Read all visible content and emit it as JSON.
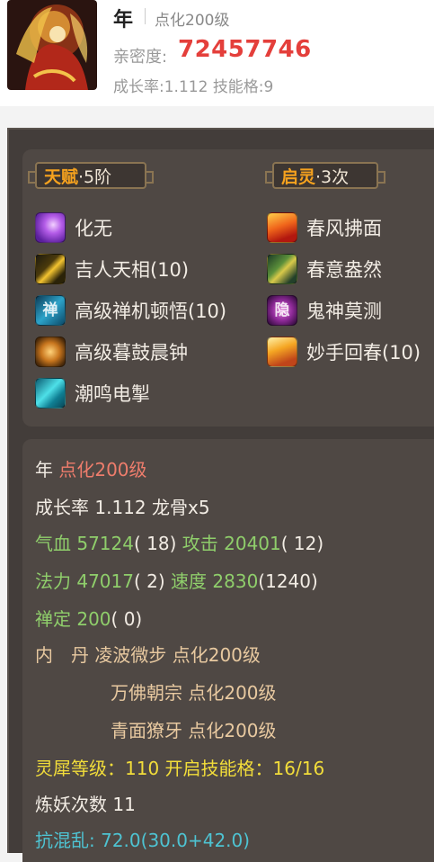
{
  "header": {
    "name": "年",
    "level": "点化200级",
    "intimacy_label": "亲密度:",
    "intimacy_value": "72457746",
    "growth_label": "成长率:1.112",
    "skill_slots_label": "技能格:9"
  },
  "talent": {
    "title": "天赋",
    "rank": "·5阶"
  },
  "awaken": {
    "title": "启灵",
    "count": "·3次"
  },
  "skills_left": [
    {
      "name": "化无",
      "icon": "huawu-icon"
    },
    {
      "name": "吉人天相(10)",
      "icon": "jiren-icon"
    },
    {
      "name": "高级禅机顿悟(10)",
      "icon": "chanji-icon",
      "glyph": "禅"
    },
    {
      "name": "高级暮鼓晨钟",
      "icon": "mugu-icon"
    },
    {
      "name": "潮鸣电掣",
      "icon": "chaoming-icon"
    }
  ],
  "skills_right": [
    {
      "name": "春风拂面",
      "icon": "chunfeng-icon"
    },
    {
      "name": "春意盎然",
      "icon": "chunyi-icon"
    },
    {
      "name": "鬼神莫测",
      "icon": "guishen-icon",
      "glyph": "隐"
    },
    {
      "name": "妙手回春(10)",
      "icon": "miaoshou-icon"
    }
  ],
  "stats": {
    "name": "年",
    "level": "点化200级",
    "growth_label": "成长率",
    "growth_value": "1.112",
    "dragon_bone": "龙骨x5",
    "hp_label": "气血",
    "hp_value": "57124",
    "hp_extra": "( 18)",
    "atk_label": "攻击",
    "atk_value": "20401",
    "atk_extra": "( 12)",
    "mp_label": "法力",
    "mp_value": "47017",
    "mp_extra": "( 2)",
    "spd_label": "速度",
    "spd_value": "2830",
    "spd_extra": "(1240)",
    "calm_label": "禅定",
    "calm_value": "200",
    "calm_extra": "( 0)",
    "inner_label": "内　丹",
    "inner_cores": [
      {
        "name": "凌波微步",
        "level": "点化200级"
      },
      {
        "name": "万佛朝宗",
        "level": "点化200级"
      },
      {
        "name": "青面獠牙",
        "level": "点化200级"
      }
    ],
    "rhino_line": "灵犀等级：110 开启技能格：16/16",
    "refine_line": "炼妖次数 11",
    "resist_label": "抗混乱:",
    "resist_value": "72.0(30.0+42.0)"
  },
  "colors": {
    "intimacy": "#e43f3b",
    "accent_orange": "#f6a21e",
    "stat_green": "#8fce6b",
    "level_red": "#ee7d6c",
    "rhino_yellow": "#f2dd3a",
    "resist_teal": "#4ec3d2"
  }
}
